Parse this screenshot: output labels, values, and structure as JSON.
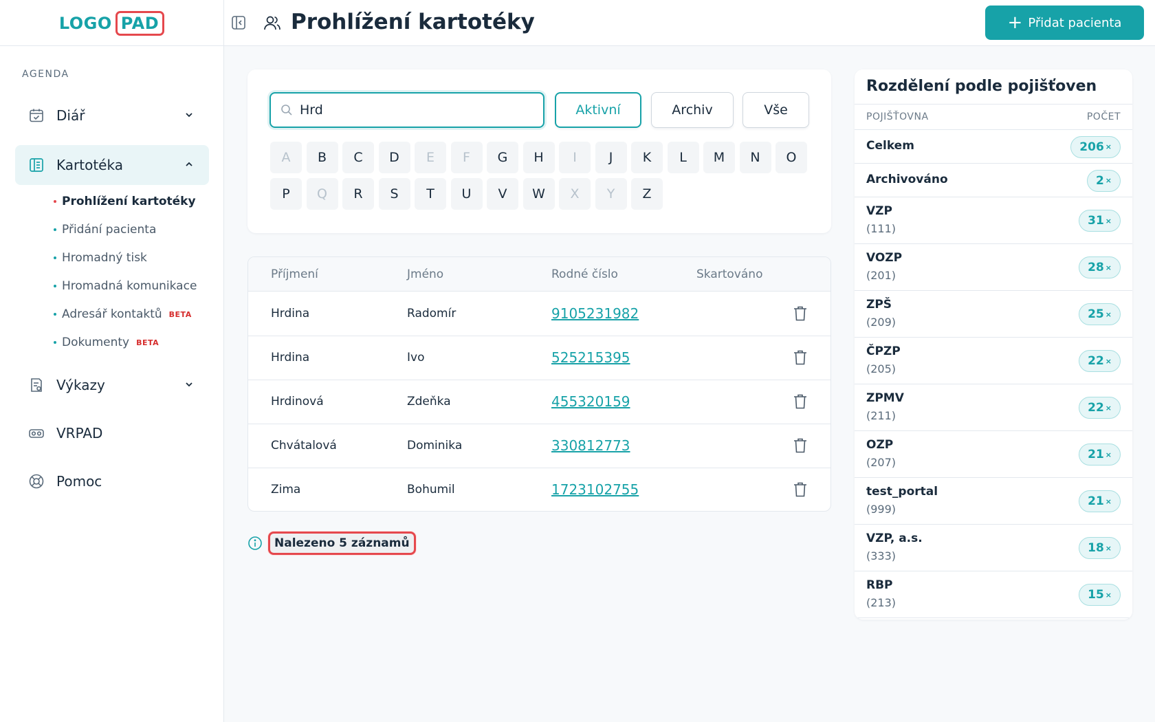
{
  "logo": {
    "part_a": "LOGO",
    "part_b": "PAD"
  },
  "header": {
    "title": "Prohlížení kartotéky",
    "add_button": "Přidat pacienta"
  },
  "sidebar": {
    "section": "AGENDA",
    "items": [
      {
        "label": "Diář"
      },
      {
        "label": "Kartotéka"
      },
      {
        "label": "Výkazy"
      },
      {
        "label": "VRPAD"
      },
      {
        "label": "Pomoc"
      }
    ],
    "subitems": [
      {
        "label": "Prohlížení kartotéky"
      },
      {
        "label": "Přidání pacienta"
      },
      {
        "label": "Hromadný tisk"
      },
      {
        "label": "Hromadná komunikace"
      },
      {
        "label": "Adresář kontaktů",
        "badge": "BETA"
      },
      {
        "label": "Dokumenty",
        "badge": "BETA"
      }
    ]
  },
  "search": {
    "value": "Hrd",
    "placeholder": ""
  },
  "filters": {
    "active": "Aktivní",
    "archive": "Archiv",
    "all": "Vše"
  },
  "letters_row1": [
    {
      "l": "A",
      "on": false
    },
    {
      "l": "B",
      "on": true
    },
    {
      "l": "C",
      "on": true
    },
    {
      "l": "D",
      "on": true
    },
    {
      "l": "E",
      "on": false
    },
    {
      "l": "F",
      "on": false
    },
    {
      "l": "G",
      "on": true
    },
    {
      "l": "H",
      "on": true
    },
    {
      "l": "I",
      "on": false
    },
    {
      "l": "J",
      "on": true
    },
    {
      "l": "K",
      "on": true
    },
    {
      "l": "L",
      "on": true
    },
    {
      "l": "M",
      "on": true
    },
    {
      "l": "N",
      "on": true
    },
    {
      "l": "O",
      "on": true
    }
  ],
  "letters_row2": [
    {
      "l": "P",
      "on": true
    },
    {
      "l": "Q",
      "on": false
    },
    {
      "l": "R",
      "on": true
    },
    {
      "l": "S",
      "on": true
    },
    {
      "l": "T",
      "on": true
    },
    {
      "l": "U",
      "on": true
    },
    {
      "l": "V",
      "on": true
    },
    {
      "l": "W",
      "on": true
    },
    {
      "l": "X",
      "on": false
    },
    {
      "l": "Y",
      "on": false
    },
    {
      "l": "Z",
      "on": true
    }
  ],
  "table": {
    "headers": [
      "Příjmení",
      "Jméno",
      "Rodné číslo",
      "Skartováno"
    ],
    "rows": [
      {
        "surname": "Hrdina",
        "name": "Radomír",
        "birth_number": "9105231982"
      },
      {
        "surname": "Hrdina",
        "name": "Ivo",
        "birth_number": "525215395"
      },
      {
        "surname": "Hrdinová",
        "name": "Zdeňka",
        "birth_number": "455320159"
      },
      {
        "surname": "Chvátalová",
        "name": "Dominika",
        "birth_number": "330812773"
      },
      {
        "surname": "Zima",
        "name": "Bohumil",
        "birth_number": "1723102755"
      }
    ]
  },
  "found": "Nalezeno 5 záznamů",
  "insurance": {
    "title": "Rozdělení podle pojišťoven",
    "col_name": "POJIŠŤOVNA",
    "col_count": "POČET",
    "rows": [
      {
        "name": "Celkem",
        "code": "",
        "count": "206"
      },
      {
        "name": "Archivováno",
        "code": "",
        "count": "2"
      },
      {
        "name": "VZP",
        "code": "(111)",
        "count": "31"
      },
      {
        "name": "VOZP",
        "code": "(201)",
        "count": "28"
      },
      {
        "name": "ZPŠ",
        "code": "(209)",
        "count": "25"
      },
      {
        "name": "ČPZP",
        "code": "(205)",
        "count": "22"
      },
      {
        "name": "ZPMV",
        "code": "(211)",
        "count": "22"
      },
      {
        "name": "OZP",
        "code": "(207)",
        "count": "21"
      },
      {
        "name": "test_portal",
        "code": "(999)",
        "count": "21"
      },
      {
        "name": "VZP, a.s.",
        "code": "(333)",
        "count": "18"
      },
      {
        "name": "RBP",
        "code": "(213)",
        "count": "15"
      }
    ],
    "count_suffix": "×"
  },
  "colors": {
    "accent": "#17a2a8",
    "highlight": "#e5484d",
    "beta": "#d62d2d"
  }
}
